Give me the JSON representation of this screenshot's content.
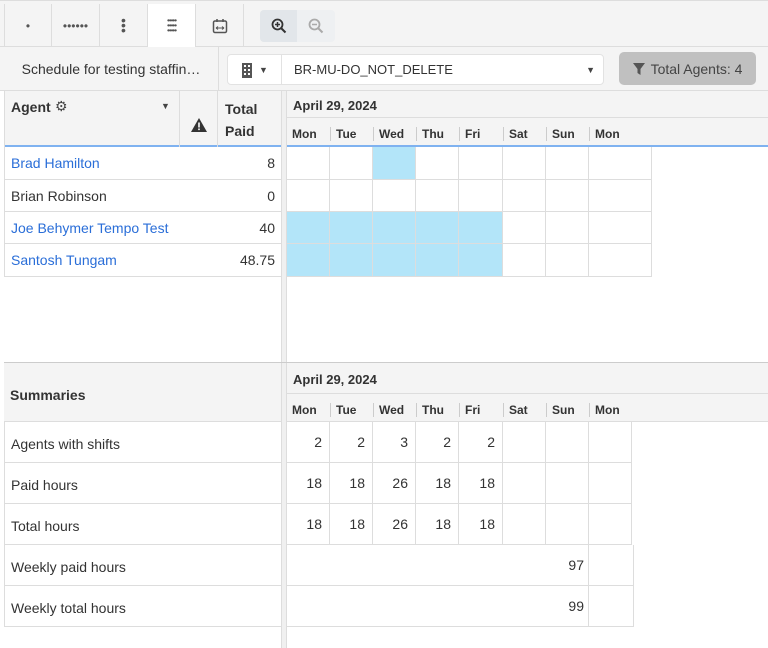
{
  "toolbar": {
    "buttons": [
      "density-1",
      "density-2",
      "density-3",
      "density-4",
      "date-range"
    ],
    "zoom_in": "zoom-in",
    "zoom_out": "zoom-out"
  },
  "header": {
    "schedule_title": "Schedule for testing staffin…",
    "site_select": "BR-MU-DO_NOT_DELETE",
    "total_agents": "Total Agents: 4"
  },
  "grid": {
    "agent_col": "Agent",
    "total_col_1": "Total",
    "total_col_2": "Paid",
    "week_label": "April 29, 2024",
    "days": [
      "Mon",
      "Tue",
      "Wed",
      "Thu",
      "Fri",
      "Sat",
      "Sun",
      "Mon"
    ],
    "agents": [
      {
        "name": "Brad Hamilton",
        "total": "8",
        "link": true,
        "shifts": [
          2
        ]
      },
      {
        "name": "Brian Robinson",
        "total": "0",
        "link": false,
        "shifts": []
      },
      {
        "name": "Joe Behymer Tempo Test",
        "total": "40",
        "link": true,
        "shifts": [
          0,
          1,
          2,
          3,
          4
        ]
      },
      {
        "name": "Santosh Tungam",
        "total": "48.75",
        "link": true,
        "shifts": [
          0,
          1,
          2,
          3,
          4
        ]
      }
    ]
  },
  "summaries": {
    "title": "Summaries",
    "week_label": "April 29, 2024",
    "rows": [
      {
        "label": "Agents with shifts",
        "values": [
          "2",
          "2",
          "3",
          "2",
          "2",
          "",
          "",
          ""
        ]
      },
      {
        "label": "Paid hours",
        "values": [
          "18",
          "18",
          "26",
          "18",
          "18",
          "",
          "",
          ""
        ]
      },
      {
        "label": "Total hours",
        "values": [
          "18",
          "18",
          "26",
          "18",
          "18",
          "",
          "",
          ""
        ]
      },
      {
        "label": "Weekly paid hours",
        "weekly": "97"
      },
      {
        "label": "Weekly total hours",
        "weekly": "99"
      }
    ]
  },
  "colors": {
    "shift": "#b3e5f9",
    "link": "#2a6ed8",
    "accent_line": "#7fb2f0"
  }
}
